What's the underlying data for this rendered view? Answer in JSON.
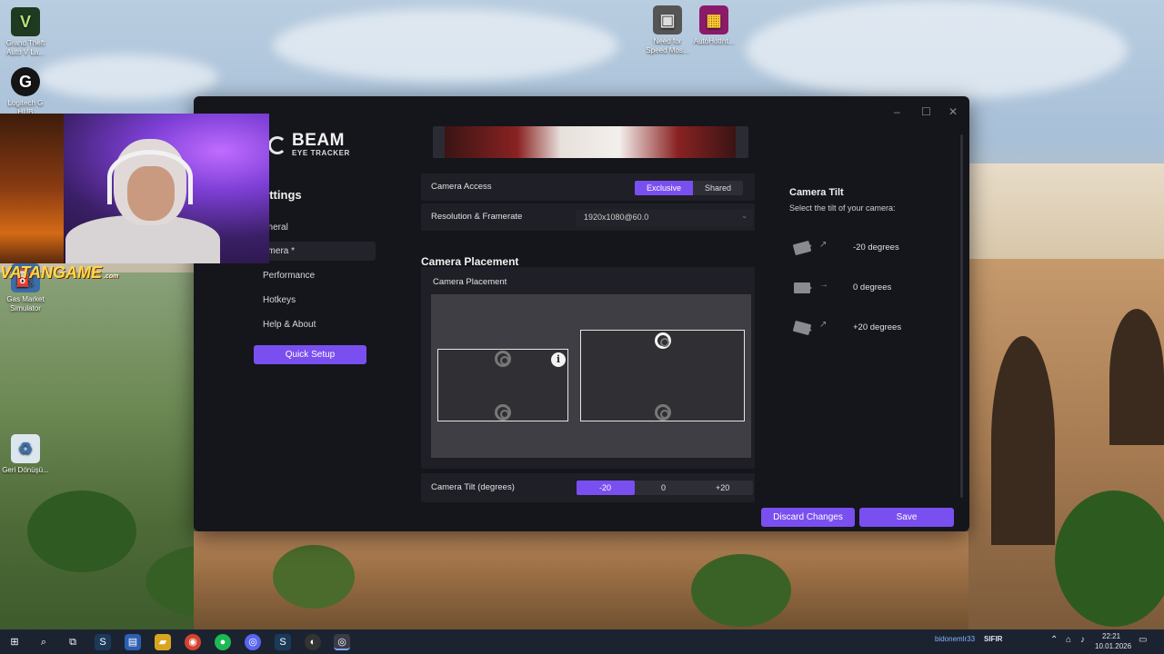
{
  "desktop": {
    "icons": [
      {
        "label": "Grand Theft Auto V La...",
        "glyph": "V"
      },
      {
        "label": "Logitech G HUB",
        "glyph": "G"
      },
      {
        "label": "Gas Market Simulator",
        "glyph": "⛽"
      },
      {
        "label": "Geri Dönüşü...",
        "glyph": "♻"
      },
      {
        "label": "Need for Speed Mos...",
        "glyph": "▣"
      },
      {
        "label": "AutoHotInt...",
        "glyph": "▦"
      }
    ],
    "overlay_brand": {
      "name": "VATANGAME",
      "suffix": ".com"
    }
  },
  "window": {
    "controls": {
      "minimize": "–",
      "maximize": "☐",
      "close": "✕"
    },
    "logo": {
      "title": "BEAM",
      "subtitle": "EYE TRACKER"
    },
    "sidebar": {
      "heading": "ettings",
      "items": [
        {
          "label": "eneral"
        },
        {
          "label": "amera *"
        },
        {
          "label": "Performance"
        },
        {
          "label": "Hotkeys"
        },
        {
          "label": "Help & About"
        }
      ],
      "quick_setup": "Quick Setup"
    },
    "camera_access": {
      "label": "Camera Access",
      "options": [
        "Exclusive",
        "Shared"
      ],
      "selected": "Exclusive"
    },
    "resolution": {
      "label": "Resolution & Framerate",
      "value": "1920x1080@60.0",
      "chevron_icon": "chevron-down-icon"
    },
    "placement": {
      "heading": "Camera Placement",
      "panel_label": "Camera Placement",
      "info_glyph": "i"
    },
    "tilt": {
      "label": "Camera Tilt (degrees)",
      "options": [
        "-20",
        "0",
        "+20"
      ],
      "selected": "-20"
    },
    "tilt_side": {
      "title": "Camera Tilt",
      "subtitle": "Select the tilt of your camera:",
      "options": [
        {
          "label": "-20 degrees",
          "arrow": "↗"
        },
        {
          "label": "0 degrees",
          "arrow": "→"
        },
        {
          "label": "+20 degrees",
          "arrow": "↗"
        }
      ]
    },
    "buttons": {
      "discard": "Discard Changes",
      "save": "Save"
    },
    "accent": "#7a4ff0"
  },
  "taskbar": {
    "apps": [
      "⊞",
      "⌕",
      "⧉",
      "S",
      "▤",
      "▰",
      "◉",
      "●",
      "◎",
      "S",
      "◐",
      "◎"
    ],
    "user": "bidonemlr33",
    "user_extra": "SIFIR",
    "time": "22:21",
    "date": "10.01.2026"
  }
}
